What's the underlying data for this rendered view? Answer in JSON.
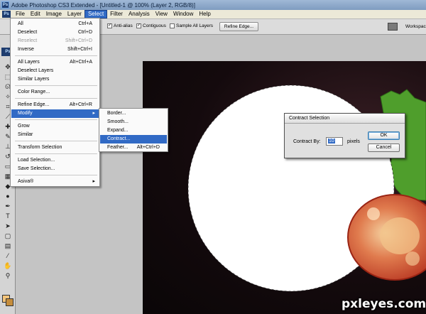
{
  "window": {
    "title": "Adobe Photoshop CS3 Extended - [Untitled-1 @ 100% (Layer 2, RGB/8)]"
  },
  "menubar": {
    "app_icon": "Ps",
    "items": [
      "File",
      "Edit",
      "Image",
      "Layer",
      "Select",
      "Filter",
      "Analysis",
      "View",
      "Window",
      "Help"
    ],
    "active": "Select"
  },
  "options": {
    "anti_alias": {
      "label": "Anti-alias",
      "checked": true
    },
    "contiguous": {
      "label": "Contiguous",
      "checked": true
    },
    "sample_all_layers": {
      "label": "Sample All Layers",
      "checked": false
    },
    "refine_edge_button": "Refine Edge...",
    "workspace_label": "Workspac"
  },
  "toolbox": {
    "badge": "Ps"
  },
  "select_menu": {
    "items": [
      {
        "label": "All",
        "shortcut": "Ctrl+A"
      },
      {
        "label": "Deselect",
        "shortcut": "Ctrl+D"
      },
      {
        "label": "Reselect",
        "shortcut": "Shift+Ctrl+D",
        "disabled": true
      },
      {
        "label": "Inverse",
        "shortcut": "Shift+Ctrl+I"
      },
      {
        "label": "All Layers",
        "shortcut": "Alt+Ctrl+A"
      },
      {
        "label": "Deselect Layers",
        "shortcut": ""
      },
      {
        "label": "Similar Layers",
        "shortcut": ""
      },
      {
        "label": "Color Range...",
        "shortcut": ""
      },
      {
        "label": "Refine Edge...",
        "shortcut": "Alt+Ctrl+R"
      },
      {
        "label": "Modify",
        "shortcut": "",
        "submenu": true,
        "selected": true
      },
      {
        "label": "Grow",
        "shortcut": ""
      },
      {
        "label": "Similar",
        "shortcut": ""
      },
      {
        "label": "Transform Selection",
        "shortcut": ""
      },
      {
        "label": "Load Selection...",
        "shortcut": ""
      },
      {
        "label": "Save Selection...",
        "shortcut": ""
      },
      {
        "label": "Asiva®",
        "shortcut": "",
        "submenu": true
      }
    ]
  },
  "modify_submenu": {
    "items": [
      {
        "label": "Border...",
        "shortcut": ""
      },
      {
        "label": "Smooth...",
        "shortcut": ""
      },
      {
        "label": "Expand...",
        "shortcut": ""
      },
      {
        "label": "Contract...",
        "shortcut": "",
        "selected": true
      },
      {
        "label": "Feather...",
        "shortcut": "Alt+Ctrl+D"
      }
    ]
  },
  "contract_dialog": {
    "title": "Contract Selection",
    "label": "Contract By:",
    "value": "10",
    "unit": "pixels",
    "ok": "OK",
    "cancel": "Cancel"
  },
  "watermark": "pxleyes.com",
  "colors": {
    "foreground": "#f3c47a",
    "background": "#c58d3c",
    "menu_highlight": "#316ac5"
  }
}
